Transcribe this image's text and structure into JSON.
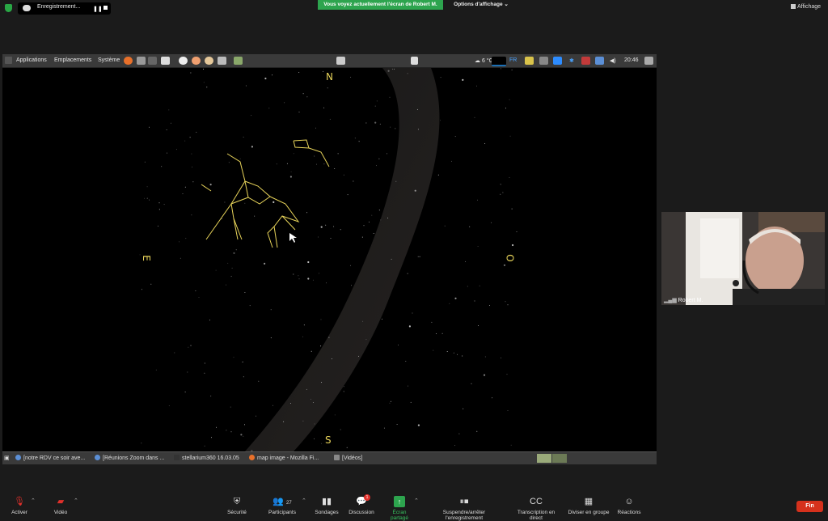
{
  "zoom": {
    "recording_label": "Enregistrement...",
    "share_banner": "Vous voyez actuellement l'écran de Robert M.",
    "view_options": "Options d'affichage",
    "display_button": "Affichage",
    "participant_name": "Robert M.",
    "participants_count": "27",
    "chat_badge": "1",
    "toolbar": {
      "activate": "Activer",
      "video": "Vidéo",
      "security": "Sécurité",
      "participants": "Participants",
      "polls": "Sondages",
      "chat": "Discussion",
      "share_screen": "Écran partagé",
      "pause_recording": "Suspendre/arrêter l'enregistrement",
      "live_transcript": "Transcription en direct",
      "breakout": "Diviser en groupe",
      "reactions": "Réactions",
      "end": "Fin"
    },
    "colors": {
      "share_green": "#2da44e",
      "end_red": "#d5311c",
      "star_line": "#e8d45a"
    }
  },
  "desktop": {
    "menus": {
      "applications": "Applications",
      "places": "Emplacements",
      "system": "Système"
    },
    "tray": {
      "temperature": "6 °C",
      "keyboard": "FR",
      "clock": "20:46"
    },
    "taskbar": [
      "[notre RDV ce soir ave...",
      "[Réunions Zoom dans ...",
      "stellarium360 16.03.05",
      "map image - Mozilla Fi...",
      "[Vidéos]"
    ]
  },
  "sky": {
    "north": "N",
    "south": "S",
    "east": "E",
    "west": "O"
  }
}
